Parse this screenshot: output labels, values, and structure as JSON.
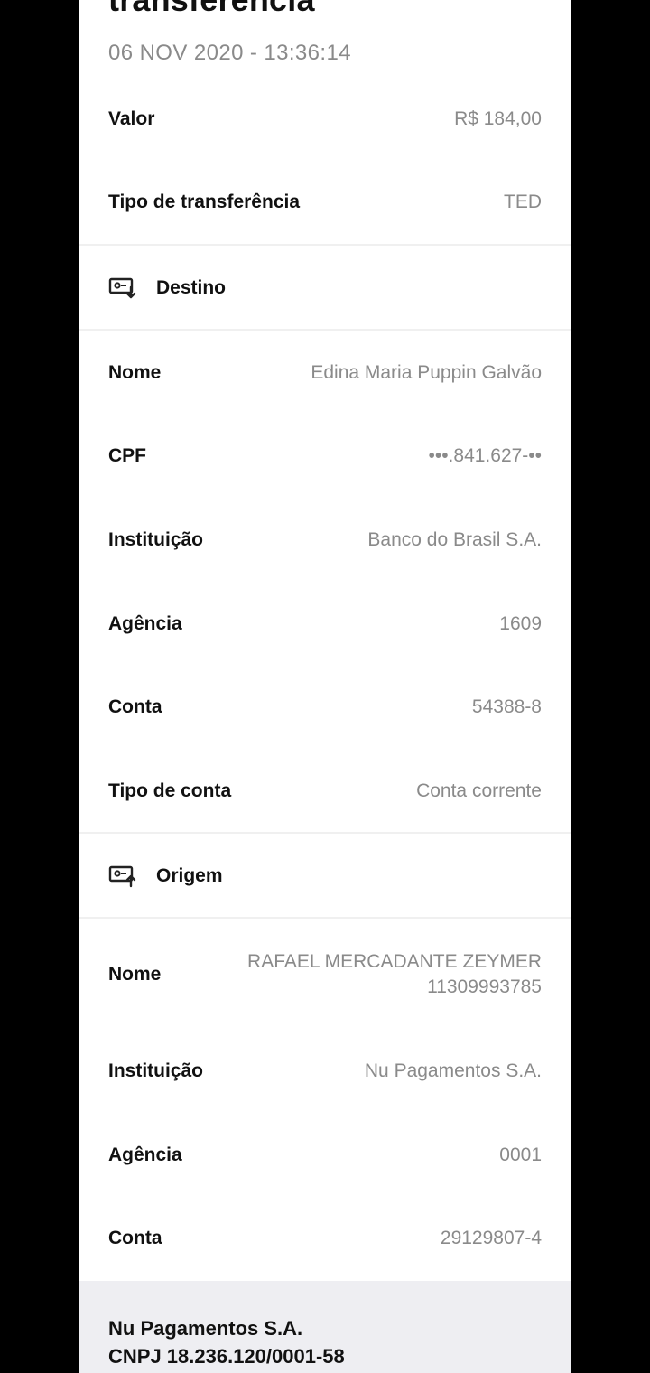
{
  "header": {
    "title": "transferência",
    "datetime": "06 NOV 2020 - 13:36:14"
  },
  "summary": {
    "valor_label": "Valor",
    "valor_value": "R$ 184,00",
    "tipo_label": "Tipo de transferência",
    "tipo_value": "TED"
  },
  "destino": {
    "section_label": "Destino",
    "icon": "screen-arrow-down-icon",
    "nome_label": "Nome",
    "nome_value": "Edina Maria Puppin Galvão",
    "cpf_label": "CPF",
    "cpf_value": "•••.841.627-••",
    "instituicao_label": "Instituição",
    "instituicao_value": "Banco do Brasil S.A.",
    "agencia_label": "Agência",
    "agencia_value": "1609",
    "conta_label": "Conta",
    "conta_value": "54388-8",
    "tipo_conta_label": "Tipo de conta",
    "tipo_conta_value": "Conta corrente"
  },
  "origem": {
    "section_label": "Origem",
    "icon": "screen-arrow-up-icon",
    "nome_label": "Nome",
    "nome_value_line1": "RAFAEL MERCADANTE ZEYMER",
    "nome_value_line2": "11309993785",
    "instituicao_label": "Instituição",
    "instituicao_value": "Nu Pagamentos S.A.",
    "agencia_label": "Agência",
    "agencia_value": "0001",
    "conta_label": "Conta",
    "conta_value": "29129807-4"
  },
  "footer": {
    "company": "Nu Pagamentos S.A.",
    "cnpj": "CNPJ 18.236.120/0001-58"
  },
  "colors": {
    "background": "#000000",
    "card": "#ffffff",
    "label": "#111111",
    "value": "#8a8a8a",
    "divider": "#f0f0f0",
    "footer": "#eeeef2"
  }
}
